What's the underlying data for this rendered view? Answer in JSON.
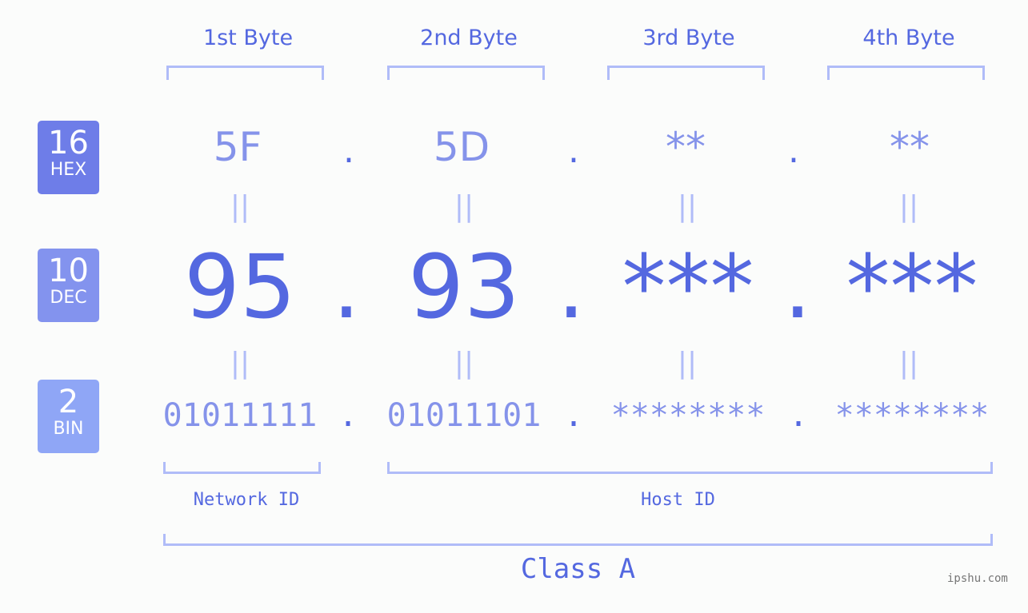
{
  "bytes": [
    {
      "label": "1st Byte",
      "hex": "5F",
      "dec": "95",
      "bin": "01011111"
    },
    {
      "label": "2nd Byte",
      "hex": "5D",
      "dec": "93",
      "bin": "01011101"
    },
    {
      "label": "3rd Byte",
      "hex": "**",
      "dec": "***",
      "bin": "********"
    },
    {
      "label": "4th Byte",
      "hex": "**",
      "dec": "***",
      "bin": "********"
    }
  ],
  "badges": {
    "hex": {
      "num": "16",
      "label": "HEX",
      "color": "#6e7de8"
    },
    "dec": {
      "num": "10",
      "label": "DEC",
      "color": "#8393ee"
    },
    "bin": {
      "num": "2",
      "label": "BIN",
      "color": "#8fa6f6"
    }
  },
  "separator": ".",
  "equals": "||",
  "network_label": "Network ID",
  "host_label": "Host ID",
  "class_label": "Class A",
  "watermark": "ipshu.com"
}
